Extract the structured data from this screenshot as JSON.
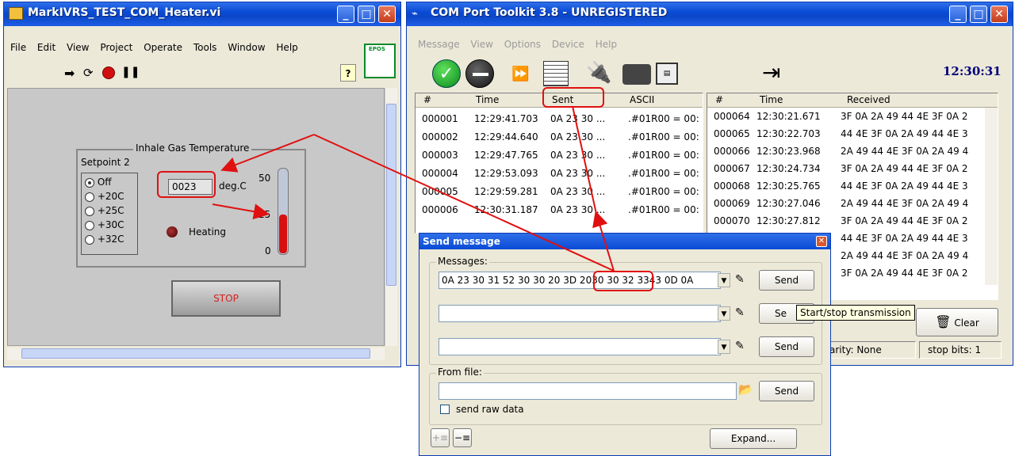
{
  "labview": {
    "title": "MarkIVRS_TEST_COM_Heater.vi",
    "menu": [
      "File",
      "Edit",
      "View",
      "Project",
      "Operate",
      "Tools",
      "Window",
      "Help"
    ],
    "epos_icon_label": "EPOS",
    "help_icon_label": "?",
    "panel": {
      "group_title": "Inhale Gas Temperature",
      "setpoint_label": "Setpoint 2",
      "radio_options": [
        "Off",
        "+20C",
        "+25C",
        "+30C",
        "+32C"
      ],
      "selected_option": "Off",
      "temp_value": "0023",
      "temp_unit": "deg.C",
      "scale_labels": [
        "50",
        "25",
        "0"
      ],
      "thermometer_level": 0.46,
      "heating_label": "Heating",
      "stop_label": "STOP"
    }
  },
  "toolkit": {
    "title": "COM Port Toolkit 3.8 - UNREGISTERED",
    "menu": [
      "Message",
      "View",
      "Options",
      "Device",
      "Help"
    ],
    "clock": "12:30:31",
    "sent_headers": [
      "#",
      "Time",
      "Sent",
      "ASCII"
    ],
    "sent_rows": [
      [
        "000001",
        "12:29:41.703",
        "0A 23 30 ...",
        ".#01R00 = 00:"
      ],
      [
        "000002",
        "12:29:44.640",
        "0A 23 30 ...",
        ".#01R00 = 00:"
      ],
      [
        "000003",
        "12:29:47.765",
        "0A 23 30 ...",
        ".#01R00 = 00:"
      ],
      [
        "000004",
        "12:29:53.093",
        "0A 23 30 ...",
        ".#01R00 = 00:"
      ],
      [
        "000005",
        "12:29:59.281",
        "0A 23 30 ...",
        ".#01R00 = 00:"
      ],
      [
        "000006",
        "12:30:31.187",
        "0A 23 30 ...",
        ".#01R00 = 00:"
      ]
    ],
    "recv_headers": [
      "#",
      "Time",
      "Received"
    ],
    "recv_rows": [
      [
        "000064",
        "12:30:21.671",
        "3F 0A 2A 49 44 4E 3F 0A 2"
      ],
      [
        "000065",
        "12:30:22.703",
        "44 4E 3F 0A 2A 49 44 4E 3"
      ],
      [
        "000066",
        "12:30:23.968",
        "2A 49 44 4E 3F 0A 2A 49 4"
      ],
      [
        "000067",
        "12:30:24.734",
        "3F 0A 2A 49 44 4E 3F 0A 2"
      ],
      [
        "000068",
        "12:30:25.765",
        "44 4E 3F 0A 2A 49 44 4E 3"
      ],
      [
        "000069",
        "12:30:27.046",
        "2A 49 44 4E 3F 0A 2A 49 4"
      ],
      [
        "000070",
        "12:30:27.812",
        "3F 0A 2A 49 44 4E 3F 0A 2"
      ],
      [
        "",
        "",
        "44 4E 3F 0A 2A 49 44 4E 3"
      ],
      [
        "",
        "",
        "2A 49 44 4E 3F 0A 2A 49 4"
      ],
      [
        "",
        "",
        "3F 0A 2A 49 44 4E 3F 0A 2"
      ]
    ],
    "clear_label": "Clear",
    "status_parity": "arity: None",
    "status_stopbits": "stop bits: 1"
  },
  "send_dialog": {
    "title": "Send message",
    "messages_label": "Messages:",
    "message_1_prefix": "0A 23 30 31 52 30 30 20 3D 20",
    "message_1_highlight": "30 30 32 33",
    "message_1_suffix": "43 0D 0A",
    "send_label": "Send",
    "send_partial_label": "Se",
    "tooltip": "Start/stop transmission",
    "from_file_label": "From file:",
    "raw_data_label": "send raw data",
    "expand_label": "Expand..."
  }
}
